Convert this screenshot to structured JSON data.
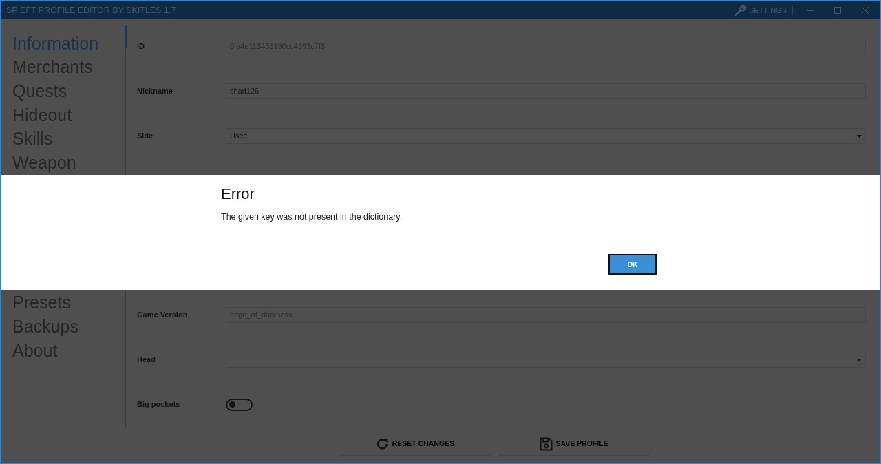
{
  "window": {
    "title": "SP EFT PROFILE EDITOR BY SKITLES 1.7",
    "settings_label": "SETTINGS"
  },
  "sidebar": {
    "top_items": [
      {
        "label": "Information",
        "selected": true
      },
      {
        "label": "Merchants",
        "selected": false
      },
      {
        "label": "Quests",
        "selected": false
      },
      {
        "label": "Hideout",
        "selected": false
      },
      {
        "label": "Skills",
        "selected": false
      },
      {
        "label": "Weapon",
        "selected": false
      }
    ],
    "bottom_items": [
      {
        "label": "Presets",
        "selected": false
      },
      {
        "label": "Backups",
        "selected": false
      },
      {
        "label": "About",
        "selected": false
      }
    ]
  },
  "form": {
    "top_rows": [
      {
        "label": "ID",
        "kind": "text",
        "value": "0fa4e113433190cc4393c7f8",
        "disabled": true
      },
      {
        "label": "Nickname",
        "kind": "text",
        "value": "chad126",
        "disabled": false
      },
      {
        "label": "Side",
        "kind": "select",
        "value": "Usec"
      }
    ],
    "bottom_rows": [
      {
        "label": "Game Version",
        "kind": "text",
        "value": "edge_of_darkness",
        "disabled": true
      },
      {
        "label": "Head",
        "kind": "select",
        "value": ""
      },
      {
        "label": "Big pockets",
        "kind": "toggle",
        "on": false
      }
    ]
  },
  "actions": [
    {
      "label": "RESET CHANGES",
      "kind": "reset"
    },
    {
      "label": "SAVE PROFILE",
      "kind": "save"
    }
  ],
  "dialog": {
    "title": "Error",
    "message": "The given key was not present in the dictionary.",
    "button": "OK"
  }
}
